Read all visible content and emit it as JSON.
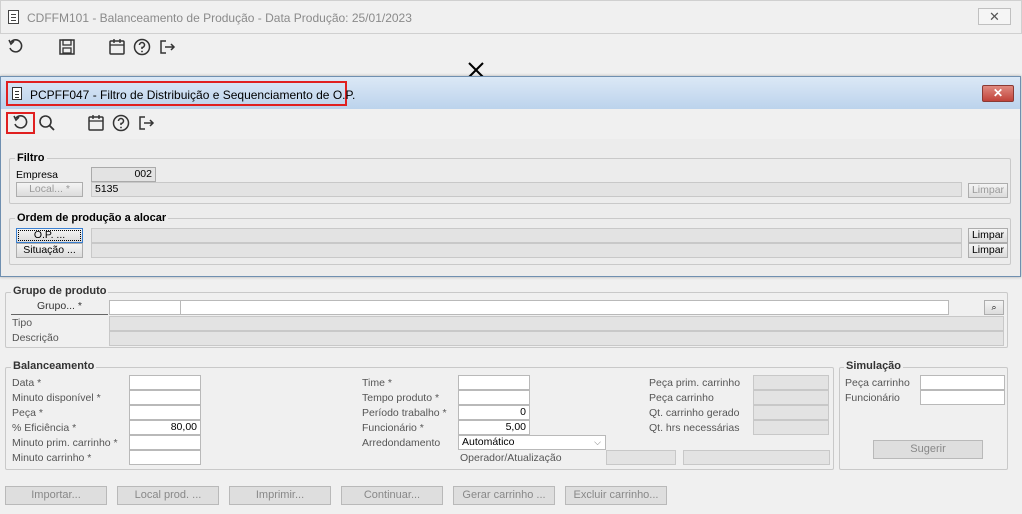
{
  "main_window": {
    "title": "CDFFM101 - Balanceamento de Produção - Data Produção: 25/01/2023",
    "toolbar_icons": [
      "refresh-icon",
      "save-icon",
      "calendar-icon",
      "help-icon",
      "exit-icon"
    ],
    "group_produto": {
      "title": "Grupo de produto",
      "grupo_btn": "Grupo... *",
      "grupo_value": "",
      "tipo_label": "Tipo",
      "descricao_label": "Descrição"
    },
    "balanceamento": {
      "title": "Balanceamento",
      "col1": [
        {
          "label": "Data *",
          "value": ""
        },
        {
          "label": "Minuto disponível *",
          "value": ""
        },
        {
          "label": "Peça *",
          "value": ""
        },
        {
          "label": "% Eficiência *",
          "value": "80,00"
        },
        {
          "label": "Minuto prim. carrinho *",
          "value": ""
        },
        {
          "label": "Minuto carrinho *",
          "value": ""
        }
      ],
      "col2": [
        {
          "label": "Time *",
          "value": ""
        },
        {
          "label": "Tempo produto *",
          "value": ""
        },
        {
          "label": "Período trabalho *",
          "value": "0"
        },
        {
          "label": "Funcionário *",
          "value": "5,00"
        },
        {
          "label": "Arredondamento",
          "value": "Automático"
        }
      ],
      "operador_label": "Operador/Atualização",
      "col3": [
        "Peça prim. carrinho",
        "Peça carrinho",
        "Qt. carrinho gerado",
        "Qt. hrs necessárias"
      ]
    },
    "simulacao": {
      "title": "Simulação",
      "peca_label": "Peça carrinho",
      "func_label": "Funcionário",
      "sugerir": "Sugerir"
    },
    "bottom_buttons": [
      "Importar...",
      "Local prod. ...",
      "Imprimir...",
      "Continuar...",
      "Gerar carrinho ...",
      "Excluir carrinho..."
    ]
  },
  "dialog": {
    "title": "PCPFF047 - Filtro de Distribuição e Sequenciamento de O.P.",
    "filtro": {
      "title": "Filtro",
      "empresa_label": "Empresa",
      "empresa_value": "002",
      "local_btn": "Local... *",
      "local_value": "5135",
      "limpar": "Limpar"
    },
    "ordem": {
      "title": "Ordem de produção a alocar",
      "op_btn": "O.P. ...",
      "situacao_btn": "Situação ...",
      "limpar1": "Limpar",
      "limpar2": "Limpar"
    }
  },
  "colors": {
    "dialog_title_bg": "#c9ddf2",
    "highlight": "#e02020",
    "close_btn": "#c9463d"
  }
}
